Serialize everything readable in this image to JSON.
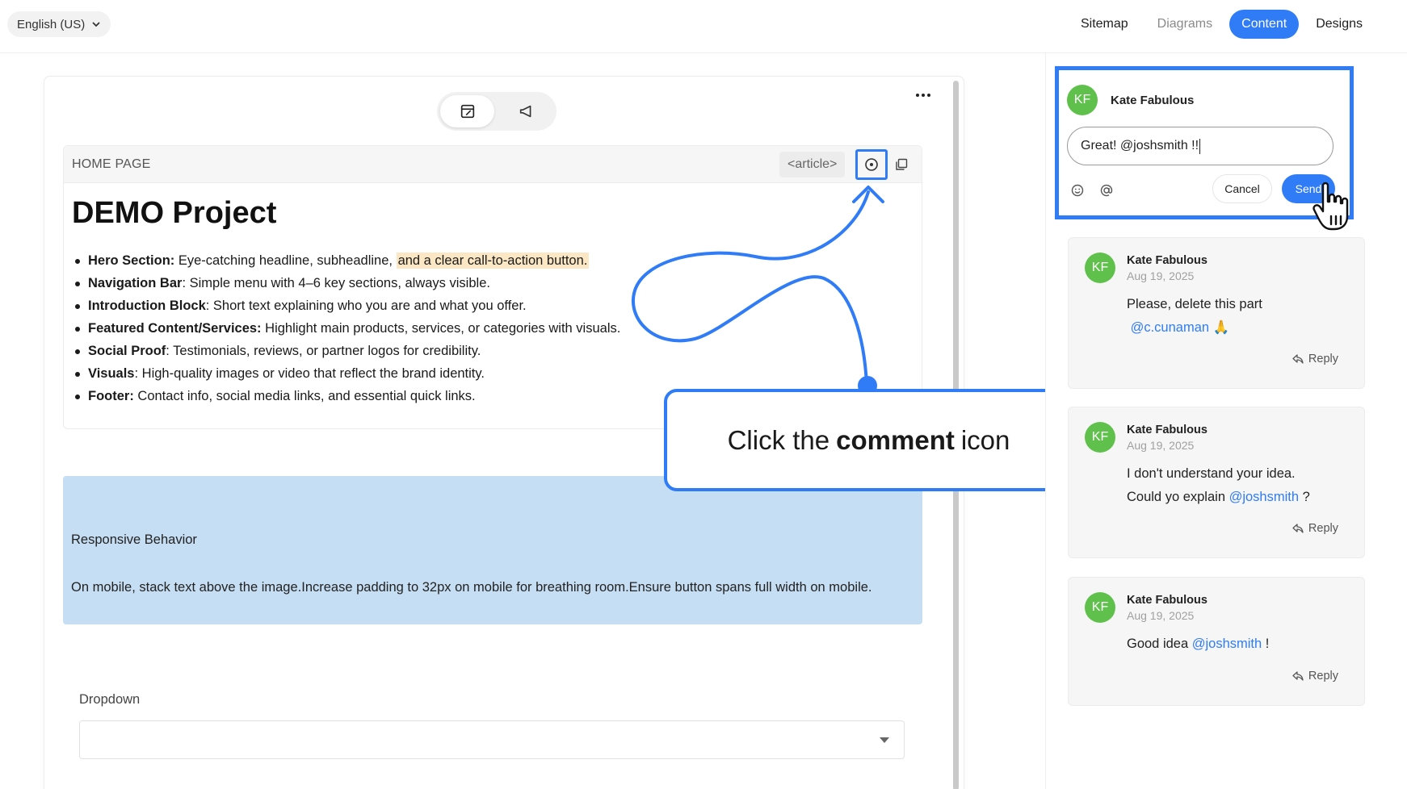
{
  "topbar": {
    "language": "English (US)",
    "nav": [
      {
        "label": "Sitemap",
        "state": "normal"
      },
      {
        "label": "Diagrams",
        "state": "muted"
      },
      {
        "label": "Content",
        "state": "active"
      },
      {
        "label": "Designs",
        "state": "normal"
      }
    ]
  },
  "editor": {
    "page_label": "HOME PAGE",
    "tag_label": "<article>",
    "title": "DEMO Project",
    "bullets": [
      {
        "bold": "Hero Section:",
        "text": " Eye-catching headline, subheadline, ",
        "highlight": "and a clear call-to-action button."
      },
      {
        "bold": "Navigation Bar",
        "text": ": Simple menu with 4–6 key sections, always visible."
      },
      {
        "bold": "Introduction Block",
        "text": ": Short text explaining who you are and what you offer."
      },
      {
        "bold": "Featured Content/Services:",
        "text": " Highlight main products, services, or categories with visuals."
      },
      {
        "bold": "Social Proof",
        "text": ": Testimonials, reviews, or partner logos for credibility."
      },
      {
        "bold": "Visuals",
        "text": ": High-quality images or video that reflect the brand identity."
      },
      {
        "bold": "Footer:",
        "text": " Contact info, social media links, and essential quick links."
      }
    ],
    "responsive_title": "Responsive Behavior",
    "responsive_text": "On mobile, stack text above the image.Increase padding to 32px on mobile for breathing room.Ensure button spans full width on mobile.",
    "dropdown_label": "Dropdown"
  },
  "callout": {
    "before": "Click the",
    "bold": "comment",
    "after": "icon"
  },
  "composer": {
    "avatar": "KF",
    "name": "Kate Fabulous",
    "input_value": "Great! @joshsmith !!",
    "cancel_label": "Cancel",
    "send_label": "Send"
  },
  "comments": [
    {
      "avatar": "KF",
      "name": "Kate Fabulous",
      "date": "Aug 19, 2025",
      "line1": "Please, delete this part",
      "mention": "@c.cunaman",
      "trail": " 🙏",
      "reply": "Reply"
    },
    {
      "avatar": "KF",
      "name": "Kate Fabulous",
      "date": "Aug 19, 2025",
      "line1": "I don't understand your idea.",
      "prefix": "Could yo explain ",
      "mention": "@joshsmith",
      "trail": " ?",
      "reply": "Reply"
    },
    {
      "avatar": "KF",
      "name": "Kate Fabulous",
      "date": "Aug 19, 2025",
      "prefix": "Good idea ",
      "mention": "@joshsmith",
      "trail": " !",
      "reply": "Reply"
    }
  ],
  "colors": {
    "accent": "#2f7cf6",
    "avatar": "#5fc14b",
    "highlight": "#fbe7c4",
    "responsive_block": "#c6def3"
  }
}
